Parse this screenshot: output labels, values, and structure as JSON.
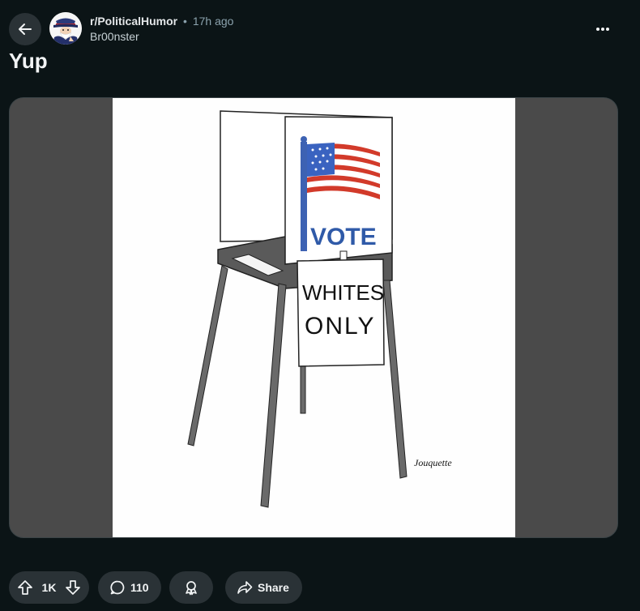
{
  "post": {
    "subreddit": "r/PoliticalHumor",
    "separator": "•",
    "time_ago": "17h ago",
    "author": "Br00nster",
    "title": "Yup"
  },
  "image": {
    "vote_text": "VOTE",
    "sign_line1": "WHITES",
    "sign_line2": "ONLY",
    "signature": "Jouquette"
  },
  "actions": {
    "upvotes": "1K",
    "comments": "110",
    "share_label": "Share"
  },
  "icons": {
    "back": "arrow-left-icon",
    "more": "ellipsis-icon",
    "upvote": "arrow-up-icon",
    "downvote": "arrow-down-icon",
    "comment": "speech-bubble-icon",
    "award": "award-icon",
    "share": "share-arrow-icon"
  },
  "colors": {
    "background": "#0b1416",
    "pill": "#2a3236",
    "muted_text": "#8ba2ad"
  }
}
